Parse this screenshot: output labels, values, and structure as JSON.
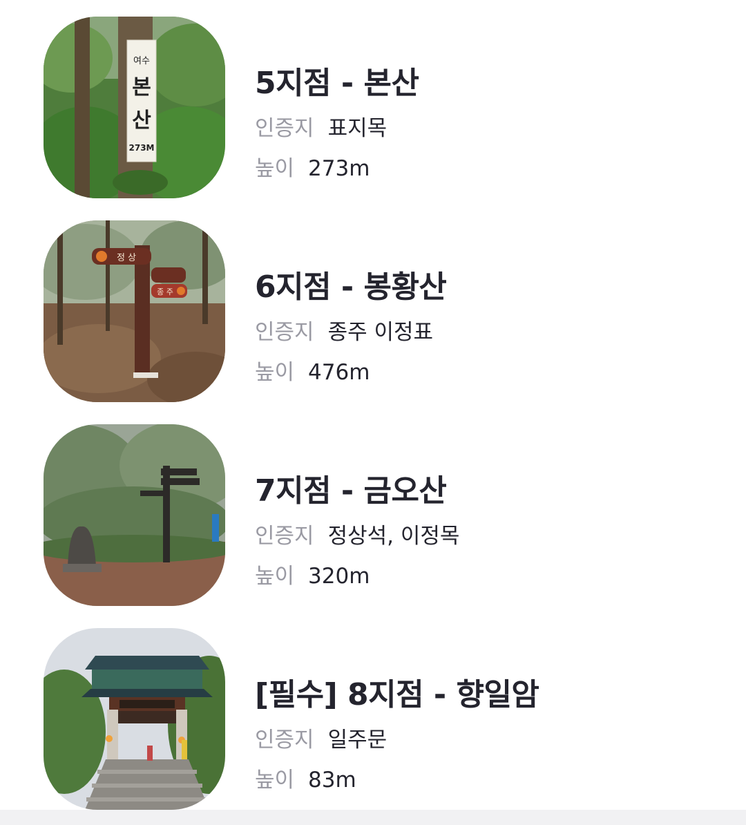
{
  "spots": [
    {
      "title": "5지점 - 본산",
      "cert_label": "인증지",
      "cert_value": "표지목",
      "height_label": "높이",
      "height_value": "273m",
      "image": "forest-signpost-photo",
      "sign_text": [
        "여수",
        "본",
        "산",
        "273M"
      ]
    },
    {
      "title": "6지점 - 봉황산",
      "cert_label": "인증지",
      "cert_value": "종주 이정표",
      "height_label": "높이",
      "height_value": "476m",
      "image": "trail-signpost-photo",
      "sign_text": [
        "정 상",
        "종 주"
      ]
    },
    {
      "title": "7지점 - 금오산",
      "cert_label": "인증지",
      "cert_value": "정상석, 이정목",
      "height_label": "높이",
      "height_value": "320m",
      "image": "summit-stone-photo"
    },
    {
      "title": "[필수] 8지점 - 향일암",
      "cert_label": "인증지",
      "cert_value": "일주문",
      "height_label": "높이",
      "height_value": "83m",
      "image": "temple-gate-photo"
    }
  ]
}
